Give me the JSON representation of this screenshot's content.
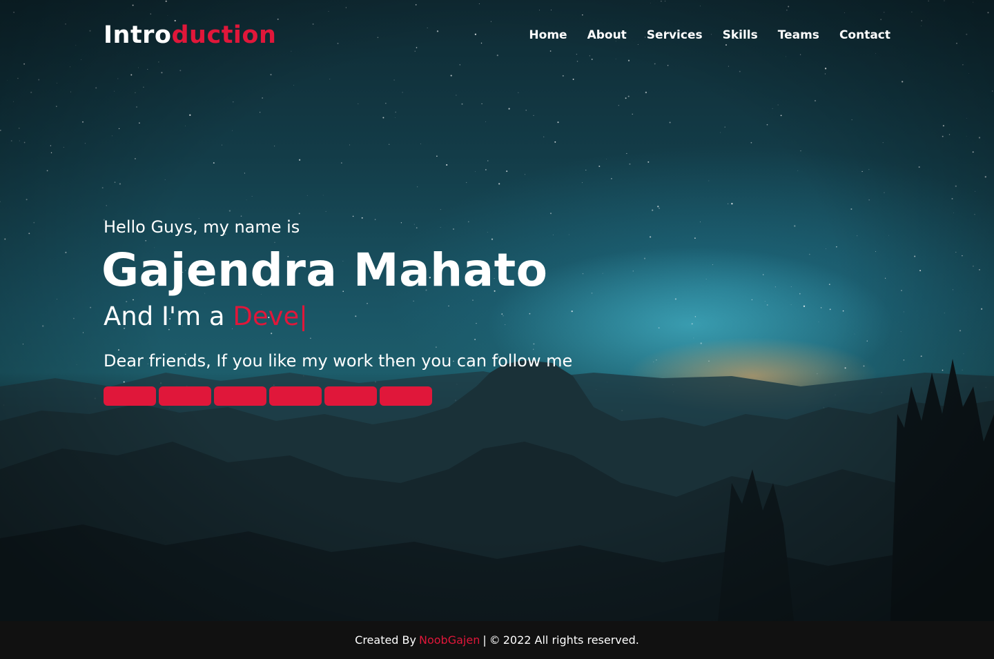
{
  "nav": {
    "logo_part1": "Intro",
    "logo_part2": "duction",
    "items": [
      {
        "label": "Home"
      },
      {
        "label": "About"
      },
      {
        "label": "Services"
      },
      {
        "label": "Skills"
      },
      {
        "label": "Teams"
      },
      {
        "label": "Contact"
      }
    ]
  },
  "hero": {
    "greeting": "Hello Guys, my name is",
    "name": "Gajendra Mahato",
    "role_prefix": "And I'm a ",
    "role_typed": "Deve|",
    "follow_text": "Dear friends, If you like my work then you can follow me",
    "social_buttons": [
      {
        "icon": "facebook-icon"
      },
      {
        "icon": "twitter-icon"
      },
      {
        "icon": "instagram-icon"
      },
      {
        "icon": "youtube-icon"
      },
      {
        "icon": "github-icon"
      },
      {
        "icon": "linkedin-icon"
      }
    ]
  },
  "footer": {
    "created_by": "Created By",
    "author": "NoobGajen",
    "separator": "|",
    "copyright_symbol": "©",
    "rights": "2022 All rights reserved."
  },
  "colors": {
    "accent": "#e0173a",
    "footer_bg": "#111111",
    "text": "#ffffff"
  }
}
